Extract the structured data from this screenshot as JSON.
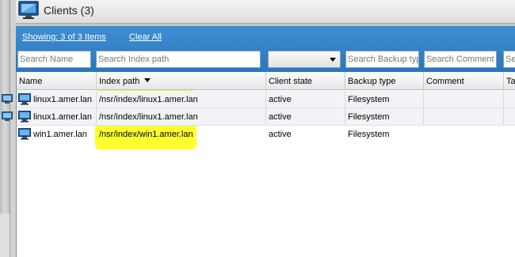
{
  "header": {
    "title": "Clients (3)",
    "icon": "client-computer-icon"
  },
  "filter": {
    "showing": "Showing: 3 of 3 Items",
    "clear_all": "Clear All",
    "search_name": "Search Name",
    "search_index_path": "Search Index path",
    "client_state_value": "",
    "search_backup_type": "Search Backup type",
    "search_comment": "Search Comment",
    "search_more": "Se"
  },
  "table": {
    "columns": [
      "Name",
      "Index path",
      "Client state",
      "Backup type",
      "Comment",
      "Ta"
    ],
    "sorted_column": "Index path",
    "highlight_color": "#ffff2e",
    "rows": [
      {
        "name": "linux1.amer.lan",
        "index_path": "/nsr/index/linux1.amer.lan",
        "client_state": "active",
        "backup_type": "Filesystem",
        "comment": ""
      },
      {
        "name": "linux1.amer.lan",
        "index_path": "/nsr/index/linux1.amer.lan",
        "client_state": "active",
        "backup_type": "Filesystem",
        "comment": ""
      },
      {
        "name": "win1.amer.lan",
        "index_path": "/nsr/index/win1.amer.lan",
        "client_state": "active",
        "backup_type": "Filesystem",
        "comment": ""
      }
    ]
  },
  "colors": {
    "filter_bar": "#2f7fc5",
    "highlight": "#ffff2e"
  }
}
